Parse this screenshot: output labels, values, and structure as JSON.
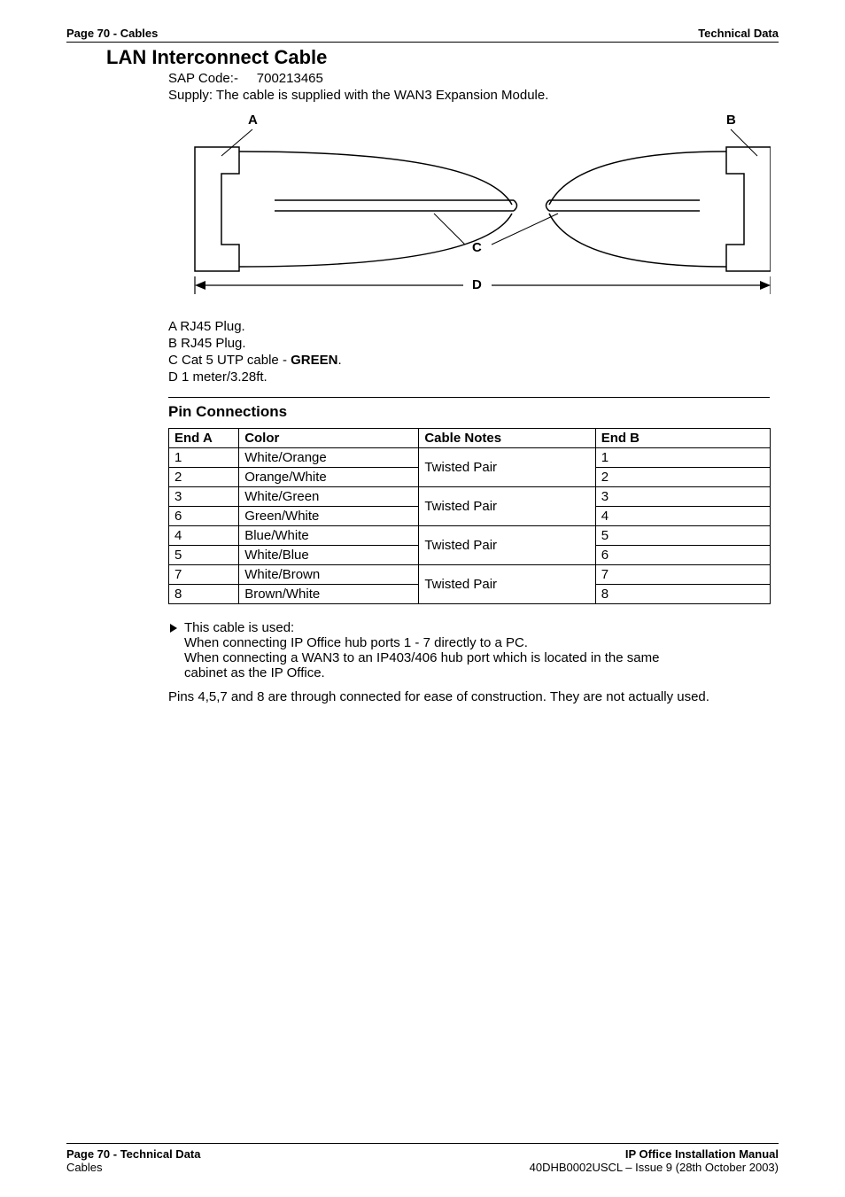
{
  "header": {
    "left": "Page 70 - Cables",
    "right": "Technical Data"
  },
  "title": "LAN Interconnect Cable",
  "sap_prefix": "SAP Code:-",
  "sap_code": "700213465",
  "supply": "Supply:  The cable is supplied with the WAN3 Expansion Module.",
  "diagram_labels": {
    "a": "A",
    "b": "B",
    "c": "C",
    "d": "D"
  },
  "legend": {
    "a": "A  RJ45 Plug.",
    "b": "B  RJ45 Plug.",
    "c_prefix": "C  Cat 5 UTP cable - ",
    "c_bold": "GREEN",
    "c_suffix": ".",
    "d": "D  1 meter/3.28ft."
  },
  "sub_header": "Pin Connections",
  "table": {
    "headers": {
      "enda": "End A",
      "color": "Color",
      "notes": "Cable Notes",
      "endb": "End B"
    },
    "rows": [
      {
        "enda": "1",
        "color": "White/Orange",
        "endb": "1"
      },
      {
        "enda": "2",
        "color": "Orange/White",
        "endb": "2"
      },
      {
        "enda": "3",
        "color": "White/Green",
        "endb": "3"
      },
      {
        "enda": "6",
        "color": "Green/White",
        "endb": "4"
      },
      {
        "enda": "4",
        "color": "Blue/White",
        "endb": "5"
      },
      {
        "enda": "5",
        "color": "White/Blue",
        "endb": "6"
      },
      {
        "enda": "7",
        "color": "White/Brown",
        "endb": "7"
      },
      {
        "enda": "8",
        "color": "Brown/White",
        "endb": "8"
      }
    ],
    "twisted_pair": "Twisted Pair"
  },
  "bullet": {
    "lead": "This cable is used:",
    "l1": "When connecting IP Office hub ports 1 - 7 directly to a PC.",
    "l2": "When connecting a WAN3 to an IP403/406 hub port which is located in the same",
    "l3": "cabinet as the IP Office."
  },
  "note": "Pins 4,5,7 and 8 are through connected for ease of construction. They are not actually used.",
  "footer": {
    "left1": "Page 70 - Technical Data",
    "left2": "Cables",
    "right1": "IP Office Installation Manual",
    "right2": "40DHB0002USCL – Issue 9 (28th October 2003)"
  }
}
